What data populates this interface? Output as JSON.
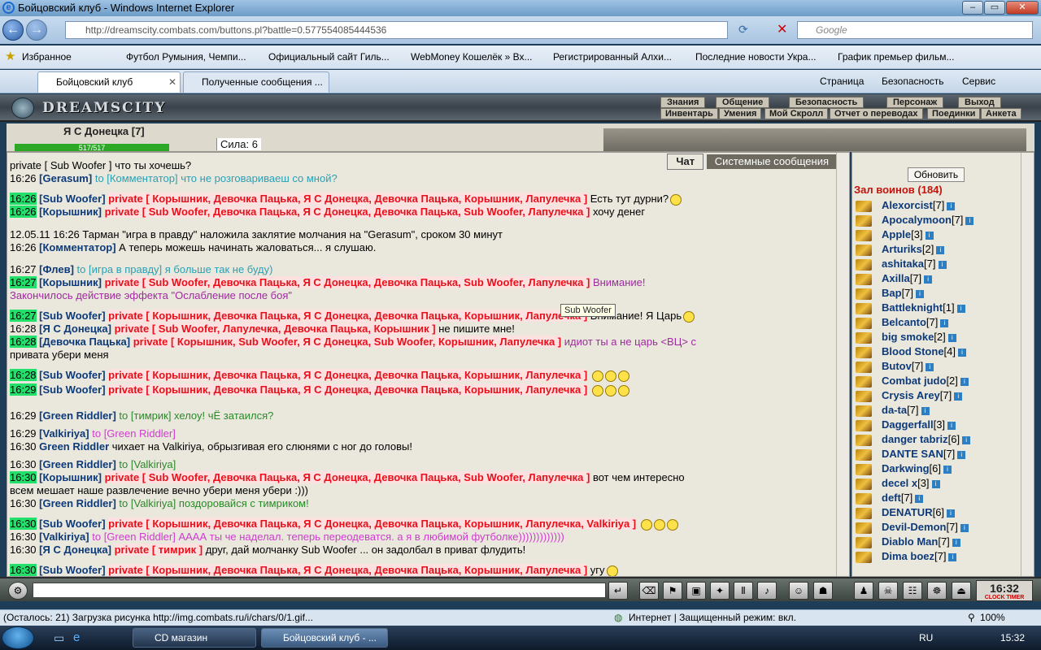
{
  "window": {
    "title": "Бойцовский клуб - Windows Internet Explorer"
  },
  "browser": {
    "url": "http://dreamscity.combats.com/buttons.pl?battle=0.577554085444536",
    "search_placeholder": "Google",
    "favorites_label": "Избранное",
    "favorites": [
      "Футбол Румыния, Чемпи...",
      "Официальный сайт Гиль...",
      "WebMoney Кошелёк » Вх...",
      "Регистрированный Алхи...",
      "Последние новости Укра...",
      "График премьер фильм..."
    ],
    "tabs": [
      "Бойцовский клуб",
      "Полученные сообщения ..."
    ],
    "commands": [
      "Страница",
      "Безопасность",
      "Сервис"
    ]
  },
  "game": {
    "logo": "DREAMSCITY",
    "menu_top": [
      "Знания",
      "Общение",
      "Безопасность",
      "Персонаж",
      "Выход"
    ],
    "menu_bottom": [
      "Инвентарь",
      "Умения",
      "Мой Скролл",
      "Отчет о переводах",
      "Поединки",
      "Анкета"
    ],
    "character": {
      "name": "Я С Донецка [7]",
      "hp": "517/517",
      "strength": "Сила: 6"
    }
  },
  "chat": {
    "tabs": [
      "Чат",
      "Системные сообщения"
    ],
    "tooltip": "Sub Woofer",
    "lines": [
      {
        "time": "",
        "parts": [
          "private [ Sub Woofer ] что ты хочешь?"
        ]
      },
      {
        "time": "16:26",
        "name": "[Gerasum]",
        "rest": "to [Комментатор] что не розговариваеш со мной?"
      },
      {
        "time": "16:26",
        "name": "[Sub Woofer]",
        "priv": "private [ Корышник, Девочка Пацька, Я С Донецка, Девочка Пацька, Корышник, Лапулечка ]",
        "rest": "Есть тут дурни?"
      },
      {
        "time": "16:26",
        "name": "[Корышник]",
        "priv": "private [ Sub Woofer, Девочка Пацька, Я С Донецка, Девочка Пацька, Sub Woofer, Лапулечка ]",
        "rest": "хочу денег"
      },
      {
        "time": "12.05.11 16:26",
        "rest": "Тарман \"игра в правду\" наложила заклятие молчания на \"Gerasum\", сроком 30 минут"
      },
      {
        "time": "16:26",
        "name": "[Комментатор]",
        "rest": "А теперь можешь начинать жаловаться... я слушаю."
      },
      {
        "time": "16:27",
        "name": "[Флев]",
        "rest": "to [игра в правду] я больше так не буду)"
      },
      {
        "time": "16:27",
        "name": "[Корышник]",
        "priv": "private [ Sub Woofer, Девочка Пацька, Я С Донецка, Девочка Пацька, Sub Woofer, Лапулечка ]",
        "rest": "Внимание!"
      },
      {
        "time": "",
        "rest": "Закончилось действие эффекта \"Ослабление после боя\""
      },
      {
        "time": "16:27",
        "name": "[Sub Woofer]",
        "priv": "private [ Корышник, Девочка Пацька, Я С Донецка, Девочка Пацька, Корышник, Лапулечка ]",
        "rest": "Внимание! Я Царь"
      },
      {
        "time": "16:28",
        "name": "[Я С Донецка]",
        "priv": "private [ Sub Woofer, Лапулечка, Девочка Пацька, Корышник ]",
        "rest": "не пишите мне!"
      },
      {
        "time": "16:28",
        "name": "[Девочка Пацька]",
        "priv": "private [ Корышник, Sub Woofer, Я С Донецка, Sub Woofer, Корышник, Лапулечка ]",
        "rest": "идиот ты а не царь <ВЦ> с"
      },
      {
        "time": "",
        "rest": "привата убери меня"
      },
      {
        "time": "16:28",
        "name": "[Sub Woofer]",
        "priv": "private [ Корышник, Девочка Пацька, Я С Донецка, Девочка Пацька, Корышник, Лапулечка ]",
        "rest": ""
      },
      {
        "time": "16:29",
        "name": "[Sub Woofer]",
        "priv": "private [ Корышник, Девочка Пацька, Я С Донецка, Девочка Пацька, Корышник, Лапулечка ]",
        "rest": ""
      },
      {
        "time": "16:29",
        "name": "[Green Riddler]",
        "rest": "to [тимрик] хелоу! чЁ затаился?"
      },
      {
        "time": "16:29",
        "name": "[Valkiriya]",
        "rest": "to [Green Riddler]"
      },
      {
        "time": "16:30",
        "name": "Green Riddler",
        "rest": "чихает на Valkiriya, обрызгивая его слюнями с ног до головы!"
      },
      {
        "time": "16:30",
        "name": "[Green Riddler]",
        "rest": "to [Valkiriya]"
      },
      {
        "time": "16:30",
        "name": "[Корышник]",
        "priv": "private [ Sub Woofer, Девочка Пацька, Я С Донецка, Девочка Пацька, Sub Woofer, Лапулечка ]",
        "rest": "вот чем интересно"
      },
      {
        "time": "",
        "rest": "всем мешает наше развлечение вечно убери меня убери :)))"
      },
      {
        "time": "16:30",
        "name": "[Green Riddler]",
        "rest": "to [Valkiriya] поздоровайся с тимриком!"
      },
      {
        "time": "16:30",
        "name": "[Sub Woofer]",
        "priv": "private [ Корышник, Девочка Пацька, Я С Донецка, Девочка Пацька, Корышник, Лапулечка, Valkiriya ]",
        "rest": ""
      },
      {
        "time": "16:30",
        "name": "[Valkiriya]",
        "rest": "to [Green Riddler] АААА ты че наделал. теперь переодеватся. а я в любимой футболке)))))))))))))"
      },
      {
        "time": "16:30",
        "name": "[Я С Донецка]",
        "priv": "private [ тимрик ]",
        "rest": "друг, дай молчанку Sub Woofer ... он задолбал в приват флудить!"
      },
      {
        "time": "16:30",
        "name": "[Sub Woofer]",
        "priv": "private [ Корышник, Девочка Пацька, Я С Донецка, Девочка Пацька, Корышник, Лапулечка ]",
        "rest": "угу"
      }
    ]
  },
  "hall": {
    "refresh": "Обновить",
    "title": "Зал воинов (184)",
    "players": [
      {
        "name": "Alexorcist",
        "lvl": "[7]"
      },
      {
        "name": "Apocalymoon",
        "lvl": "[7]"
      },
      {
        "name": "Apple",
        "lvl": "[3]"
      },
      {
        "name": "Arturiks",
        "lvl": "[2]"
      },
      {
        "name": "ashitaka",
        "lvl": "[7]"
      },
      {
        "name": "Axilla",
        "lvl": "[7]"
      },
      {
        "name": "Bap",
        "lvl": "[7]"
      },
      {
        "name": "Battleknight",
        "lvl": "[1]"
      },
      {
        "name": "Belcanto",
        "lvl": "[7]"
      },
      {
        "name": "big smoke",
        "lvl": "[2]"
      },
      {
        "name": "Blood Stone",
        "lvl": "[4]"
      },
      {
        "name": "Butov",
        "lvl": "[7]"
      },
      {
        "name": "Combat judo",
        "lvl": "[2]"
      },
      {
        "name": "Crysis Arey",
        "lvl": "[7]"
      },
      {
        "name": "da-ta",
        "lvl": "[7]"
      },
      {
        "name": "Daggerfall",
        "lvl": "[3]"
      },
      {
        "name": "danger tabriz",
        "lvl": "[6]"
      },
      {
        "name": "DANTE SAN",
        "lvl": "[7]"
      },
      {
        "name": "Darkwing",
        "lvl": "[6]"
      },
      {
        "name": "decel x",
        "lvl": "[3]"
      },
      {
        "name": "deft",
        "lvl": "[7]"
      },
      {
        "name": "DENATUR",
        "lvl": "[6]"
      },
      {
        "name": "Devil-Demon",
        "lvl": "[7]"
      },
      {
        "name": "Diablo Man",
        "lvl": "[7]"
      },
      {
        "name": "Dima boez",
        "lvl": "[7]"
      }
    ]
  },
  "clock": {
    "time": "16:32",
    "label": "CLOCK TIMER"
  },
  "status": {
    "text": "(Осталось: 21) Загрузка рисунка http://img.combats.ru/i/chars/0/1.gif...",
    "zone": "Интернет | Защищенный режим: вкл.",
    "zoom": "100%"
  },
  "taskbar": {
    "tasks": [
      "CD магазин",
      "Бойцовский клуб - ..."
    ],
    "lang": "RU",
    "time": "15:32"
  }
}
